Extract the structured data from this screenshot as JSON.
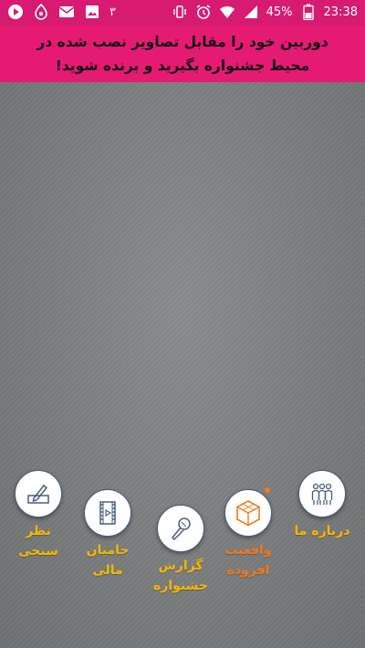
{
  "status_bar": {
    "time": "23:38",
    "battery": "45%",
    "notification_count": "۳",
    "icons": [
      "play-icon",
      "app-icon",
      "mail-icon",
      "image-icon",
      "vibrate-icon",
      "alarm-icon",
      "wifi-icon",
      "signal-icon",
      "battery-icon"
    ]
  },
  "banner": {
    "line1": "دوربین خود را مقابل تصاویر نصب شده در",
    "line2": "محیط جشنواره بگیرید و برنده شوید!"
  },
  "menu": {
    "poll": {
      "line1": "نظر",
      "line2": "سنجی",
      "icon": "pencil-icon"
    },
    "sponsors": {
      "line1": "حامیان",
      "line2": "مالی",
      "icon": "film-icon"
    },
    "report": {
      "line1": "گزارش",
      "line2": "جشنواره",
      "icon": "microphone-icon"
    },
    "ar": {
      "line1": "واقعیت",
      "line2": "افزوده",
      "icon": "cube-icon"
    },
    "about": {
      "line1": "درباره ما",
      "icon": "people-icon"
    }
  },
  "colors": {
    "accent": "#e51a73",
    "label": "#f5b800",
    "active_label": "#f07a1e"
  }
}
